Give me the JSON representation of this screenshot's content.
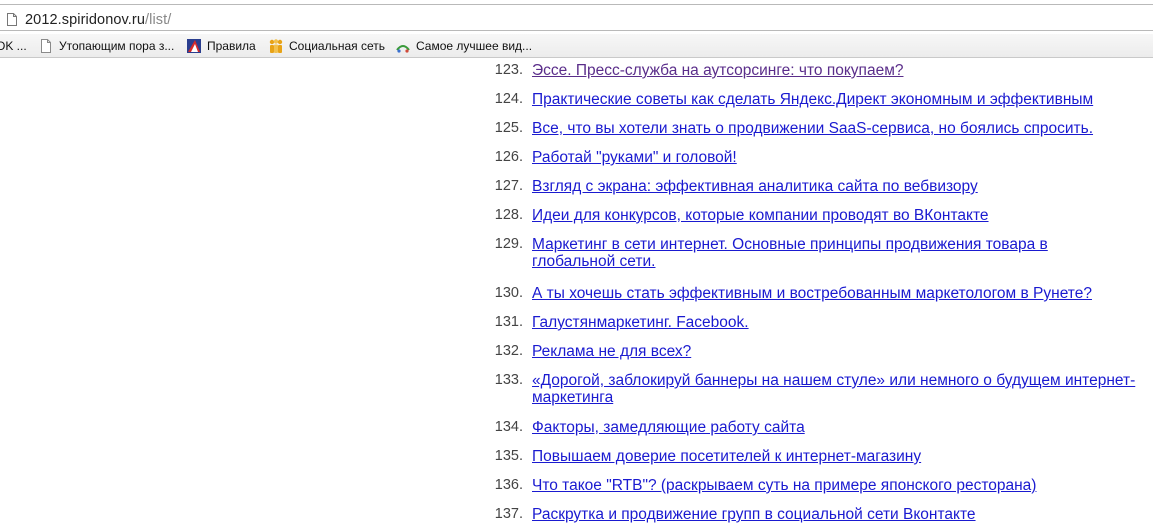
{
  "address_bar": {
    "url_host": "2012.spiridonov.ru",
    "url_path": "/list/"
  },
  "bookmarks": [
    {
      "label": "OK ...",
      "icon": "none"
    },
    {
      "label": "Утопающим пора з...",
      "icon": "page-icon"
    },
    {
      "label": "Правила",
      "icon": "brand-icon"
    },
    {
      "label": "Социальная сеть",
      "icon": "people-icon"
    },
    {
      "label": "Самое лучшее вид...",
      "icon": "site-icon"
    }
  ],
  "list": {
    "items": [
      {
        "number": "123.",
        "lines": [
          "Эссе. Пресс-служба на аутсорсинге: что покупаем?"
        ],
        "visited": true
      },
      {
        "number": "124.",
        "lines": [
          "Практические советы как сделать Яндекс.Директ экономным и эффективным"
        ],
        "visited": false
      },
      {
        "number": "125.",
        "lines": [
          "Все, что вы хотели знать о продвижении SaaS-сервиса, но боялись спросить."
        ],
        "visited": false
      },
      {
        "number": "126.",
        "lines": [
          "Работай \"руками\" и головой!"
        ],
        "visited": false
      },
      {
        "number": "127.",
        "lines": [
          "Взгляд с экрана: эффективная аналитика сайта по вебвизору"
        ],
        "visited": false
      },
      {
        "number": "128.",
        "lines": [
          "Идеи для конкурсов, которые компании проводят во ВКонтакте"
        ],
        "visited": false
      },
      {
        "number": "129.",
        "lines": [
          "Маркетинг в сети интернет. Основные принципы продвижения товара в",
          "глобальной сети."
        ],
        "visited": false
      },
      {
        "number": "130.",
        "lines": [
          "А ты хочешь стать эффективным и востребованным маркетологом в Рунете?"
        ],
        "visited": false
      },
      {
        "number": "131.",
        "lines": [
          "Галустянмаркетинг. Facebook."
        ],
        "visited": false
      },
      {
        "number": "132.",
        "lines": [
          "Реклама не для всех?"
        ],
        "visited": false
      },
      {
        "number": "133.",
        "lines": [
          "«Дорогой, заблокируй баннеры на нашем стуле» или немного о будущем интернет-",
          "маркетинга"
        ],
        "visited": false
      },
      {
        "number": "134.",
        "lines": [
          "Факторы, замедляющие работу сайта"
        ],
        "visited": false
      },
      {
        "number": "135.",
        "lines": [
          "Повышаем доверие посетителей к интернет-магазину"
        ],
        "visited": false
      },
      {
        "number": "136.",
        "lines": [
          "Что такое \"RTB\"? (раскрываем суть на примере японского ресторана)"
        ],
        "visited": false
      },
      {
        "number": "137.",
        "lines": [
          "Раскрутка и продвижение групп в социальной сети Вконтакте"
        ],
        "visited": false
      }
    ]
  }
}
